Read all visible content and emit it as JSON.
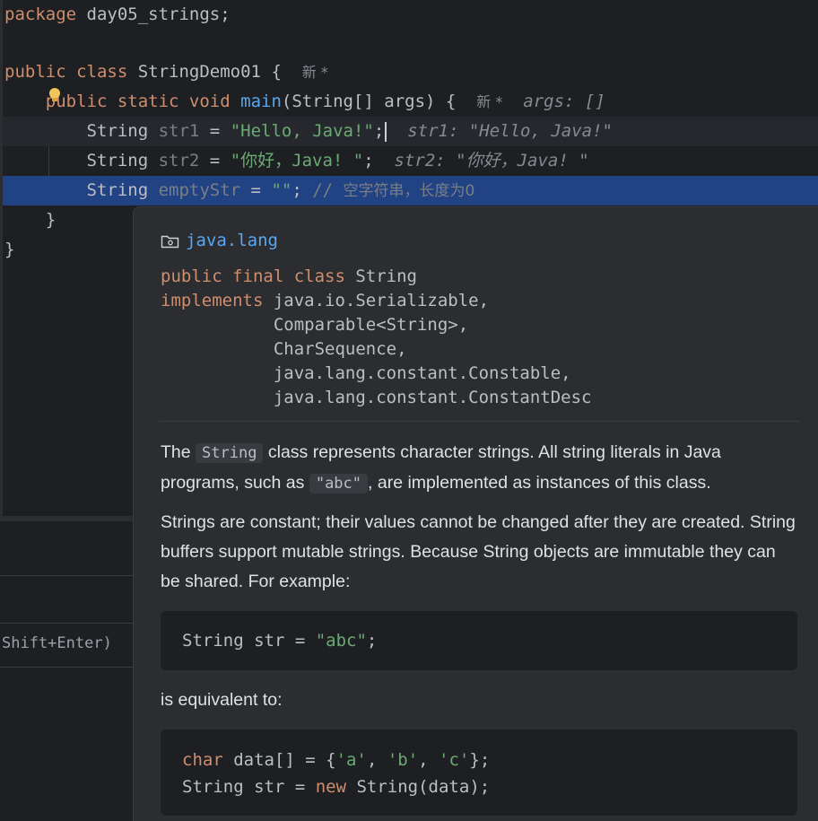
{
  "editor": {
    "line1": {
      "kw": "package",
      "rest": " day05_strings;"
    },
    "line2": {
      "kw": "public class",
      "name": " StringDemo01 ",
      "brace": "{",
      "badge": "新 *"
    },
    "line3": {
      "kw": "ublic static void",
      "p": "p",
      "fn": "main",
      "params": "(String[] args) {",
      "badge": "新 *",
      "hint": "args: []"
    },
    "line4": {
      "type": "String ",
      "var": "str1",
      "eq": " = ",
      "value": "\"Hello, Java!\"",
      "semi": ";",
      "hint": "str1: \"Hello, Java!\""
    },
    "line5": {
      "type": "String ",
      "var": "str2",
      "eq": " = ",
      "value": "\"你好，Java! \"",
      "semi": ";",
      "hint": "str2: \"你好，Java! \""
    },
    "line6": {
      "type": "String ",
      "var": "emptyStr",
      "eq": " = ",
      "value": "\"\"",
      "semi": "; ",
      "comment_mark": "// ",
      "comment": "空字符串，长度为0"
    },
    "line7": {
      "brace": "}"
    },
    "line8": {
      "brace": "}"
    }
  },
  "lower_panel": {
    "shortcut": "Shift+Enter)"
  },
  "popup": {
    "package": "java.lang",
    "decl": {
      "modifiers": "public final class",
      "class_name": " String",
      "implements_kw": "implements",
      "interfaces": [
        "java.io.Serializable,",
        "Comparable<String>,",
        "CharSequence,",
        "java.lang.constant.Constable,",
        "java.lang.constant.ConstantDesc"
      ]
    },
    "para1": {
      "t1": "The ",
      "c1": "String",
      "t2": " class represents character strings. All string literals in Java programs, such as ",
      "c2": "\"abc\"",
      "t3": ", are implemented as instances of this class."
    },
    "para2": "Strings are constant; their values cannot be changed after they are created. String buffers support mutable strings. Because String objects are immutable they can be shared. For example:",
    "example1": {
      "type": "String str = ",
      "value": "\"abc\"",
      "semi": ";"
    },
    "para3": "is equivalent to:",
    "example2": {
      "l1_kw": "char",
      "l1_a": " data[] = {",
      "l1_v1": "'a'",
      "l1_c1": ", ",
      "l1_v2": "'b'",
      "l1_c2": ", ",
      "l1_v3": "'c'",
      "l1_end": "};",
      "l2_a": "String str = ",
      "l2_kw": "new",
      "l2_b": " String(data);"
    }
  },
  "colors": {
    "background": "#1e1f22",
    "keyword": "#cf8e6d",
    "function": "#56a8f5",
    "string": "#6aab73",
    "selection": "#214283",
    "popup_bg": "#2b2d30"
  }
}
